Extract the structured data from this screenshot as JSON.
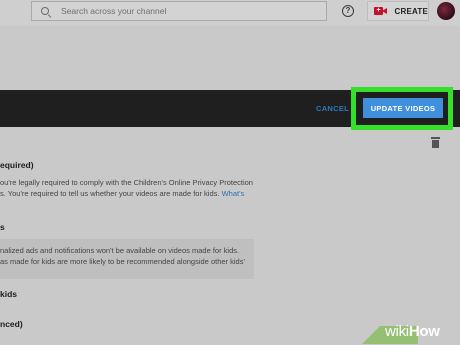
{
  "header": {
    "search_placeholder": "Search across your channel",
    "help_icon": "?",
    "create_label": "CREATE"
  },
  "action_bar": {
    "cancel_label": "CANCEL",
    "update_label": "UPDATE VIDEOS",
    "highlight_color": "#35e02c",
    "button_color": "#3f8fdc"
  },
  "content": {
    "section1_title": "equired)",
    "section1_line1": "ou're legally required to comply with the Children's Online Privacy Protection",
    "section1_line2": "s. You're required to tell us whether your videos are made for kids.",
    "section1_link": "What's",
    "section2_title": "s",
    "note_line1": "nalized ads and notifications won't be available on videos made for kids.",
    "note_line2": "as made for kids are more likely to be recommended alongside other kids'",
    "option1": "kids",
    "option2": "nced)"
  },
  "watermark": {
    "wiki": "wiki",
    "how": "How"
  }
}
